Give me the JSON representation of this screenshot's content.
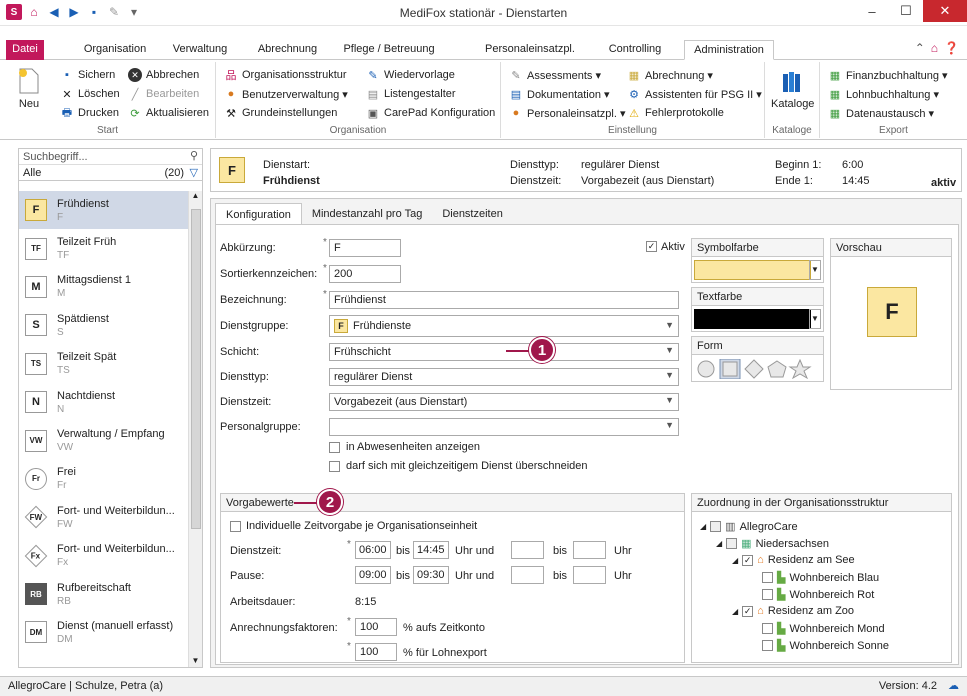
{
  "window": {
    "title": "MediFox stationär - Dienstarten",
    "app_icon": "S"
  },
  "ribbon_tabs": [
    "Datei",
    "Organisation",
    "Verwaltung",
    "Abrechnung",
    "Pflege / Betreuung",
    "Personaleinsatzpl.",
    "Controlling",
    "Administration"
  ],
  "ribbon": {
    "start": {
      "label": "Start",
      "neu": "Neu",
      "sichern": "Sichern",
      "abbrechen": "Abbrechen",
      "loeschen": "Löschen",
      "bearbeiten": "Bearbeiten",
      "drucken": "Drucken",
      "aktualisieren": "Aktualisieren"
    },
    "organisation": {
      "label": "Organisation",
      "orgstruktur": "Organisationsstruktur",
      "wiedervorlage": "Wiedervorlage",
      "benutzerverwaltung": "Benutzerverwaltung ▾",
      "listengestalter": "Listengestalter",
      "grundeinstellungen": "Grundeinstellungen",
      "carepad": "CarePad Konfiguration"
    },
    "einstellung": {
      "label": "Einstellung",
      "assessments": "Assessments ▾",
      "abrechnung": "Abrechnung ▾",
      "dokumentation": "Dokumentation ▾",
      "assistenten": "Assistenten für PSG II ▾",
      "personaleinsatz": "Personaleinsatzpl. ▾",
      "fehlerprotokolle": "Fehlerprotokolle"
    },
    "kataloge": {
      "label": "Kataloge",
      "kataloge": "Kataloge"
    },
    "export": {
      "label": "Export",
      "fibu": "Finanzbuchhaltung ▾",
      "lohn": "Lohnbuchhaltung ▾",
      "daten": "Datenaustausch ▾"
    }
  },
  "left": {
    "search_placeholder": "Suchbegriff...",
    "filter": "Alle",
    "count": "(20)",
    "items": [
      {
        "badge": "F",
        "name": "Frühdienst",
        "short": "F"
      },
      {
        "badge": "TF",
        "name": "Teilzeit Früh",
        "short": "TF"
      },
      {
        "badge": "M",
        "name": "Mittagsdienst 1",
        "short": "M"
      },
      {
        "badge": "S",
        "name": "Spätdienst",
        "short": "S"
      },
      {
        "badge": "TS",
        "name": "Teilzeit Spät",
        "short": "TS"
      },
      {
        "badge": "N",
        "name": "Nachtdienst",
        "short": "N"
      },
      {
        "badge": "VW",
        "name": "Verwaltung / Empfang",
        "short": "VW"
      },
      {
        "badge": "Fr",
        "name": "Frei",
        "short": "Fr"
      },
      {
        "badge": "FW",
        "name": "Fort- und Weiterbildun...",
        "short": "FW"
      },
      {
        "badge": "Fx",
        "name": "Fort- und Weiterbildun...",
        "short": "Fx"
      },
      {
        "badge": "RB",
        "name": "Rufbereitschaft",
        "short": "RB"
      },
      {
        "badge": "DM",
        "name": "Dienst (manuell erfasst)",
        "short": "DM"
      }
    ]
  },
  "header": {
    "badge": "F",
    "dienstart_label": "Dienstart:",
    "dienstart": "Frühdienst",
    "typ_label": "Diensttyp:",
    "typ": "regulärer Dienst",
    "zeit_label": "Dienstzeit:",
    "zeit": "Vorgabezeit (aus Dienstart)",
    "beginn_label": "Beginn 1:",
    "beginn": "6:00",
    "ende_label": "Ende 1:",
    "ende": "14:45",
    "status": "aktiv"
  },
  "tabs": [
    "Konfiguration",
    "Mindestanzahl pro Tag",
    "Dienstzeiten"
  ],
  "form": {
    "abk_label": "Abkürzung:",
    "abk": "F",
    "aktiv_label": "Aktiv",
    "sort_label": "Sortierkennzeichen:",
    "sort": "200",
    "bez_label": "Bezeichnung:",
    "bez": "Frühdienst",
    "gruppe_label": "Dienstgruppe:",
    "gruppe_badge": "F",
    "gruppe": "Frühdienste",
    "schicht_label": "Schicht:",
    "schicht": "Frühschicht",
    "typ_label": "Diensttyp:",
    "typ": "regulärer Dienst",
    "zeit_label": "Dienstzeit:",
    "zeit": "Vorgabezeit (aus Dienstart)",
    "pg_label": "Personalgruppe:",
    "pg": "",
    "abw": "in Abwesenheiten anzeigen",
    "ueber": "darf sich mit gleichzeitigem Dienst überschneiden"
  },
  "symbol": {
    "symbolfarbe": "Symbolfarbe",
    "textfarbe": "Textfarbe",
    "form": "Form",
    "vorschau": "Vorschau",
    "preview_letter": "F",
    "symbol_color": "#fbe7a1",
    "text_color": "#000000"
  },
  "vorgabe": {
    "title": "Vorgabewerte",
    "indiv": "Individuelle Zeitvorgabe je Organisationseinheit",
    "dz_label": "Dienstzeit:",
    "dz_from": "06:00",
    "bis": "bis",
    "dz_to": "14:45",
    "uhr_und": "Uhr  und",
    "uhr": "Uhr",
    "p_label": "Pause:",
    "p_from": "09:00",
    "p_to": "09:30",
    "ad_label": "Arbeitsdauer:",
    "ad": "8:15",
    "af_label": "Anrechnungsfaktoren:",
    "af1": "100",
    "af1_unit": "% aufs Zeitkonto",
    "af2": "100",
    "af2_unit": "% für Lohnexport"
  },
  "org": {
    "title": "Zuordnung in der Organisationsstruktur",
    "nodes": [
      "AllegroCare",
      "Niedersachsen",
      "Residenz am See",
      "Wohnbereich Blau",
      "Wohnbereich Rot",
      "Residenz am Zoo",
      "Wohnbereich Mond",
      "Wohnbereich Sonne"
    ]
  },
  "callouts": [
    "1",
    "2"
  ],
  "status": {
    "left": "AllegroCare | Schulze, Petra (a)",
    "version": "Version: 4.2"
  }
}
